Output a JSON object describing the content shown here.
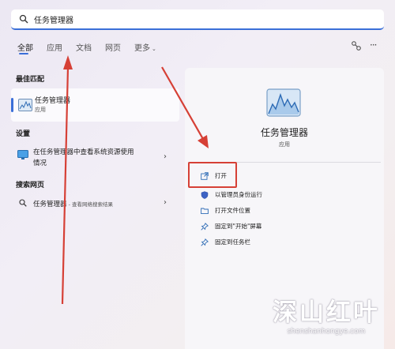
{
  "search": {
    "query": "任务管理器"
  },
  "tabs": [
    "全部",
    "应用",
    "文档",
    "网页",
    "更多"
  ],
  "sections": {
    "best": "最佳匹配",
    "settings": "设置",
    "web": "搜索网页"
  },
  "best_match": {
    "name": "任务管理器",
    "type": "应用"
  },
  "setting_item": {
    "line1": "在任务管理器中查看系统资源使用",
    "line2": "情况"
  },
  "web_item": {
    "name": "任务管理器",
    "hint": " - 查看网络搜索结果"
  },
  "detail": {
    "title": "任务管理器",
    "subtitle": "应用",
    "actions": [
      "打开",
      "以管理员身份运行",
      "打开文件位置",
      "固定到\"开始\"屏幕",
      "固定到任务栏"
    ]
  },
  "watermark": {
    "main": "深山红叶",
    "sub": "shenshanhongye.com"
  },
  "colors": {
    "accent": "#3a6fd8",
    "annotation": "#d64036"
  }
}
